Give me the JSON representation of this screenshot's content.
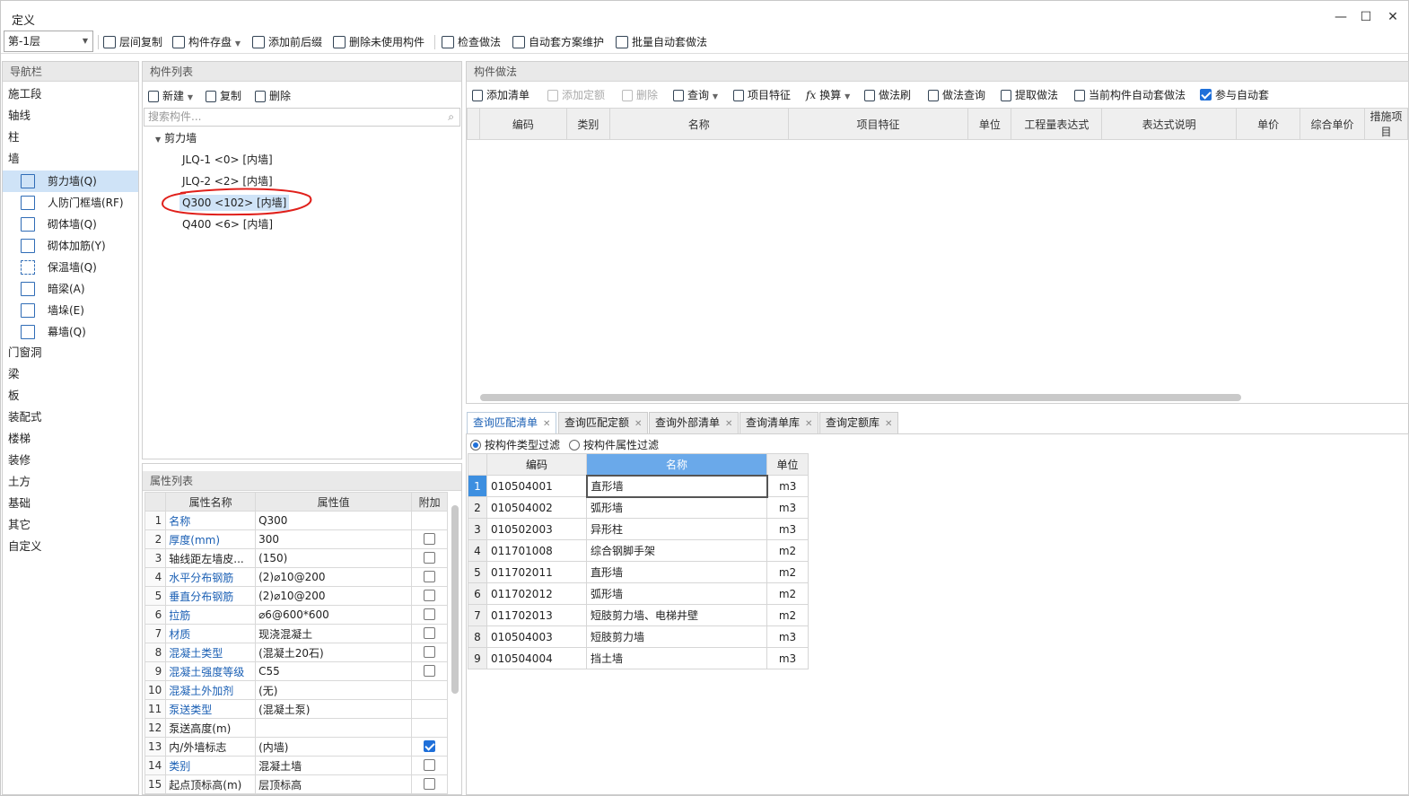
{
  "window": {
    "title": "定义",
    "min": "—",
    "max": "☐",
    "close": "✕"
  },
  "toolbar": {
    "floor": "第-1层",
    "buttons": [
      "层间复制",
      "构件存盘",
      "添加前后缀",
      "删除未使用构件",
      "检查做法",
      "自动套方案维护",
      "批量自动套做法"
    ]
  },
  "nav": {
    "title": "导航栏",
    "top": [
      "施工段",
      "轴线",
      "柱",
      "墙"
    ],
    "wall_items": [
      "剪力墙(Q)",
      "人防门框墙(RF)",
      "砌体墙(Q)",
      "砌体加筋(Y)",
      "保温墙(Q)",
      "暗梁(A)",
      "墙垛(E)",
      "幕墙(Q)"
    ],
    "bottom": [
      "门窗洞",
      "梁",
      "板",
      "装配式",
      "楼梯",
      "装修",
      "土方",
      "基础",
      "其它",
      "自定义"
    ]
  },
  "components": {
    "title": "构件列表",
    "new": "新建",
    "copy": "复制",
    "delete": "删除",
    "search_placeholder": "搜索构件...",
    "group": "剪力墙",
    "items": [
      "JLQ-1 <0> [内墙]",
      "JLQ-2 <2> [内墙]",
      "Q300 <102> [内墙]",
      "Q400 <6> [内墙]"
    ]
  },
  "props": {
    "title": "属性列表",
    "headers": [
      "属性名称",
      "属性值",
      "附加"
    ],
    "rows": [
      {
        "n": "1",
        "name": "名称",
        "value": "Q300",
        "blue": true,
        "cb": ""
      },
      {
        "n": "2",
        "name": "厚度(mm)",
        "value": "300",
        "blue": true,
        "cb": "off"
      },
      {
        "n": "3",
        "name": "轴线距左墙皮...",
        "value": "(150)",
        "blue": false,
        "cb": "off"
      },
      {
        "n": "4",
        "name": "水平分布钢筋",
        "value": "(2)⌀10@200",
        "blue": true,
        "cb": "off"
      },
      {
        "n": "5",
        "name": "垂直分布钢筋",
        "value": "(2)⌀10@200",
        "blue": true,
        "cb": "off"
      },
      {
        "n": "6",
        "name": "拉筋",
        "value": "⌀6@600*600",
        "blue": true,
        "cb": "off"
      },
      {
        "n": "7",
        "name": "材质",
        "value": "现浇混凝土",
        "blue": true,
        "cb": "off"
      },
      {
        "n": "8",
        "name": "混凝土类型",
        "value": "(混凝土20石)",
        "blue": true,
        "cb": "off"
      },
      {
        "n": "9",
        "name": "混凝土强度等级",
        "value": "C55",
        "blue": true,
        "cb": "off"
      },
      {
        "n": "10",
        "name": "混凝土外加剂",
        "value": "(无)",
        "blue": true,
        "cb": ""
      },
      {
        "n": "11",
        "name": "泵送类型",
        "value": "(混凝土泵)",
        "blue": true,
        "cb": ""
      },
      {
        "n": "12",
        "name": "泵送高度(m)",
        "value": "",
        "blue": false,
        "cb": ""
      },
      {
        "n": "13",
        "name": "内/外墙标志",
        "value": "(内墙)",
        "blue": false,
        "cb": "on"
      },
      {
        "n": "14",
        "name": "类别",
        "value": "混凝土墙",
        "blue": true,
        "cb": "off"
      },
      {
        "n": "15",
        "name": "起点顶标高(m)",
        "value": "层顶标高",
        "blue": false,
        "cb": "off"
      }
    ]
  },
  "methods": {
    "title": "构件做法",
    "buttons": [
      "添加清单",
      "添加定额",
      "删除",
      "查询",
      "项目特征",
      "换算",
      "做法刷",
      "做法查询",
      "提取做法",
      "当前构件自动套做法",
      "参与自动套"
    ],
    "headers": [
      "编码",
      "类别",
      "名称",
      "项目特征",
      "单位",
      "工程量表达式",
      "表达式说明",
      "单价",
      "综合单价",
      "措施项目"
    ]
  },
  "query": {
    "tabs": [
      "查询匹配清单",
      "查询匹配定额",
      "查询外部清单",
      "查询清单库",
      "查询定额库"
    ],
    "filter_type": "按构件类型过滤",
    "filter_attr": "按构件属性过滤",
    "headers": [
      "编码",
      "名称",
      "单位"
    ],
    "rows": [
      {
        "n": "1",
        "code": "010504001",
        "name": "直形墙",
        "unit": "m3"
      },
      {
        "n": "2",
        "code": "010504002",
        "name": "弧形墙",
        "unit": "m3"
      },
      {
        "n": "3",
        "code": "010502003",
        "name": "异形柱",
        "unit": "m3"
      },
      {
        "n": "4",
        "code": "011701008",
        "name": "综合钢脚手架",
        "unit": "m2"
      },
      {
        "n": "5",
        "code": "011702011",
        "name": "直形墙",
        "unit": "m2"
      },
      {
        "n": "6",
        "code": "011702012",
        "name": "弧形墙",
        "unit": "m2"
      },
      {
        "n": "7",
        "code": "011702013",
        "name": "短肢剪力墙、电梯井壁",
        "unit": "m2"
      },
      {
        "n": "8",
        "code": "010504003",
        "name": "短肢剪力墙",
        "unit": "m3"
      },
      {
        "n": "9",
        "code": "010504004",
        "name": "挡土墙",
        "unit": "m3"
      }
    ]
  },
  "colors": {
    "accent": "#1e6fd9",
    "selection": "#cfe3f7",
    "annotation": "#e0201b"
  }
}
